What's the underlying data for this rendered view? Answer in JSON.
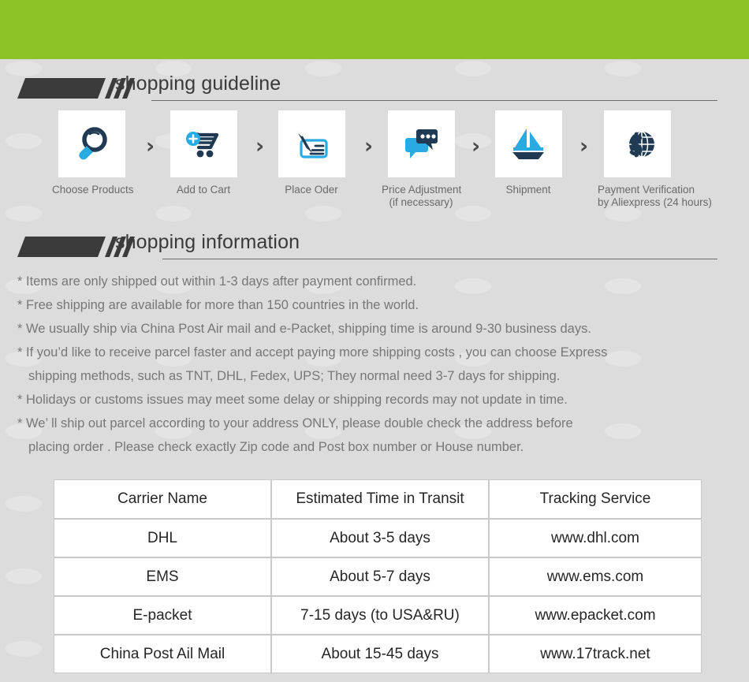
{
  "colors": {
    "banner_green": "#8CC225",
    "background_gray": "#DCDCDC",
    "icon_dark_navy": "#1F3A52",
    "icon_light_blue": "#29ABE2",
    "text_gray": "#777777",
    "heading_dark": "#3A3A3A",
    "table_border": "#C9C9C9"
  },
  "sections": {
    "guideline": {
      "title": "shopping guideline"
    },
    "information": {
      "title": "shopping information"
    }
  },
  "steps": [
    {
      "icon": "magnifier-icon",
      "label_line1": "Choose Products",
      "label_line2": ""
    },
    {
      "icon": "add-to-cart-icon",
      "label_line1": "Add to Cart",
      "label_line2": ""
    },
    {
      "icon": "pen-check-icon",
      "label_line1": "Place Oder",
      "label_line2": ""
    },
    {
      "icon": "chat-bubbles-icon",
      "label_line1": "Price Adjustment",
      "label_line2": "(if necessary)"
    },
    {
      "icon": "sailboat-icon",
      "label_line1": "Shipment",
      "label_line2": ""
    },
    {
      "icon": "dollar-globe-icon",
      "label_line1": "Payment Verification",
      "label_line2": "by  Aliexpress (24 hours)"
    }
  ],
  "step_separator": "›",
  "information_lines": [
    {
      "main": "* Items are only shipped out within 1-3 days after payment confirmed.",
      "cont": ""
    },
    {
      "main": "* Free shipping are available for more than 150 countries in the world.",
      "cont": ""
    },
    {
      "main": "* We usually ship via China Post Air mail and e-Packet, shipping time is around 9-30 business days.",
      "cont": ""
    },
    {
      "main": "* If you’d like to receive parcel faster and accept paying more shipping costs , you can choose Express",
      "cont": "shipping methods, such as TNT, DHL, Fedex, UPS; They normal need 3-7 days for shipping."
    },
    {
      "main": "* Holidays or customs issues may meet some delay or shipping records may not update in time.",
      "cont": ""
    },
    {
      "main": "* We’ ll ship out parcel according to your address ONLY, please double check the address before",
      "cont": "placing order . Please check exactly Zip code and Post box number or House number."
    }
  ],
  "carrier_table": {
    "headers": [
      "Carrier Name",
      "Estimated Time in Transit",
      "Tracking Service"
    ],
    "rows": [
      [
        "DHL",
        "About 3-5 days",
        "www.dhl.com"
      ],
      [
        "EMS",
        "About 5-7 days",
        "www.ems.com"
      ],
      [
        "E-packet",
        "7-15 days (to USA&RU)",
        "www.epacket.com"
      ],
      [
        "China Post Ail Mail",
        "About 15-45 days",
        "www.17track.net"
      ]
    ]
  }
}
